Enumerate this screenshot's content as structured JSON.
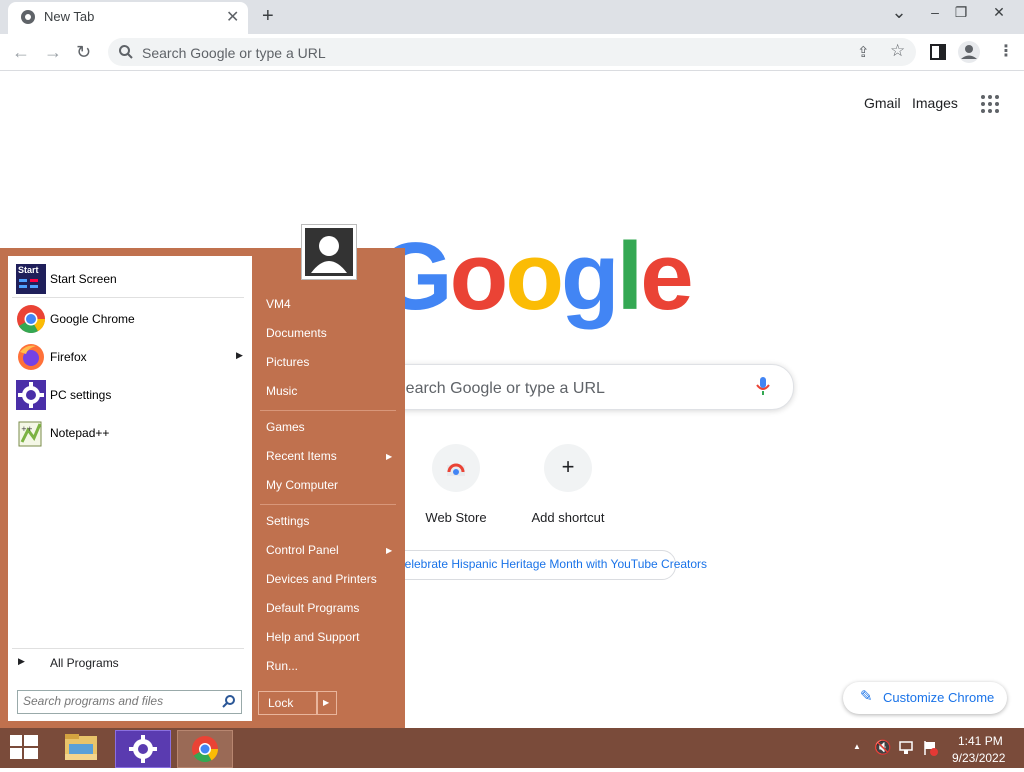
{
  "browser": {
    "tab_title": "New Tab",
    "tab_close": "✕",
    "new_tab": "+",
    "window_controls": {
      "chevron": "⌄",
      "minimize": "–",
      "restore": "❐",
      "close": "✕"
    },
    "omnibox_placeholder": "Search Google or type a URL"
  },
  "page": {
    "gmail": "Gmail",
    "images": "Images",
    "logo": [
      "G",
      "o",
      "o",
      "g",
      "l",
      "e"
    ],
    "logo_colors": [
      "#4285f4",
      "#ea4335",
      "#fbbc05",
      "#4285f4",
      "#34a853",
      "#ea4335"
    ],
    "search_placeholder": "Search Google or type a URL",
    "shortcuts": [
      {
        "label": "Web Store",
        "icon": "webstore-icon"
      },
      {
        "label": "Add shortcut",
        "icon": "plus-icon"
      }
    ],
    "promo": "Celebrate Hispanic Heritage Month with YouTube Creators",
    "customize": "Customize Chrome"
  },
  "start_menu": {
    "left_items": [
      {
        "label": "Start Screen",
        "icon": "start-screen-icon"
      },
      {
        "label": "Google Chrome",
        "icon": "chrome-icon"
      },
      {
        "label": "Firefox",
        "icon": "firefox-icon"
      },
      {
        "label": "PC settings",
        "icon": "gear-icon"
      },
      {
        "label": "Notepad++",
        "icon": "notepad-icon"
      }
    ],
    "start_icon_text": "Start",
    "all_programs": "All Programs",
    "search_placeholder": "Search programs and files",
    "right_items": [
      "VM4",
      "Documents",
      "Pictures",
      "Music",
      "Games",
      "Recent Items",
      "My Computer",
      "Settings",
      "Control Panel",
      "Devices and Printers",
      "Default Programs",
      "Help and Support",
      "Run..."
    ],
    "lock": "Lock"
  },
  "taskbar": {
    "time": "1:41 PM",
    "date": "9/23/2022",
    "accent": "#7a4b3a"
  }
}
